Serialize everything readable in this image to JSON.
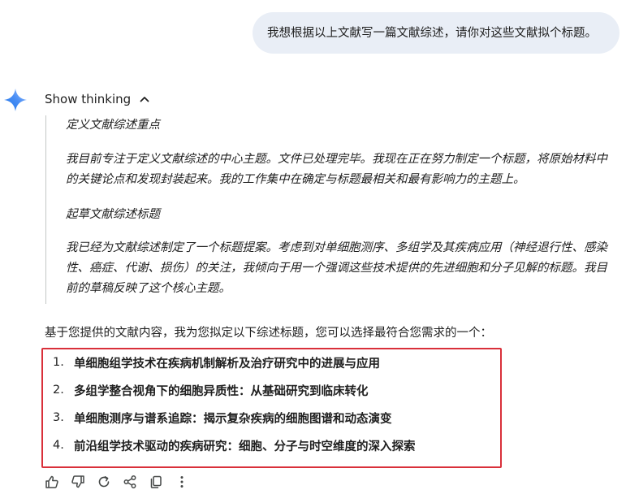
{
  "user_message": "我想根据以上文献写一篇文献综述，请你对这些文献拟个标题。",
  "thinking": {
    "toggle_label": "Show thinking",
    "sections": [
      {
        "heading": "定义文献综述重点"
      },
      {
        "body": "我目前专注于定义文献综述的中心主题。文件已处理完毕。我现在正在努力制定一个标题，将原始材料中的关键论点和发现封装起来。我的工作集中在确定与标题最相关和最有影响力的主题上。"
      },
      {
        "heading": "起草文献综述标题"
      },
      {
        "body": "我已经为文献综述制定了一个标题提案。考虑到对单细胞测序、多组学及其疾病应用（神经退行性、感染性、癌症、代谢、损伤）的关注，我倾向于用一个强调这些技术提供的先进细胞和分子见解的标题。我目前的草稿反映了这个核心主题。"
      }
    ]
  },
  "response": {
    "intro": "基于您提供的文献内容，我为您拟定以下综述标题，您可以选择最符合您需求的一个：",
    "titles": [
      {
        "num": "1.",
        "text": "单细胞组学技术在疾病机制解析及治疗研究中的进展与应用"
      },
      {
        "num": "2.",
        "text": "多组学整合视角下的细胞异质性：从基础研究到临床转化"
      },
      {
        "num": "3.",
        "text": "单细胞测序与谱系追踪：揭示复杂疾病的细胞图谱和动态演变"
      },
      {
        "num": "4.",
        "text": "前沿组学技术驱动的疾病研究：细胞、分子与时空维度的深入探索"
      }
    ]
  },
  "actions": [
    {
      "name": "thumbs-up-icon"
    },
    {
      "name": "thumbs-down-icon"
    },
    {
      "name": "regenerate-icon"
    },
    {
      "name": "share-icon"
    },
    {
      "name": "copy-icon"
    },
    {
      "name": "more-options-icon"
    }
  ],
  "colors": {
    "user_bubble_bg": "#e9eef6",
    "highlight_border": "#d9303a",
    "thinking_rule": "#c4c7c5",
    "icon_gray": "#444746"
  }
}
